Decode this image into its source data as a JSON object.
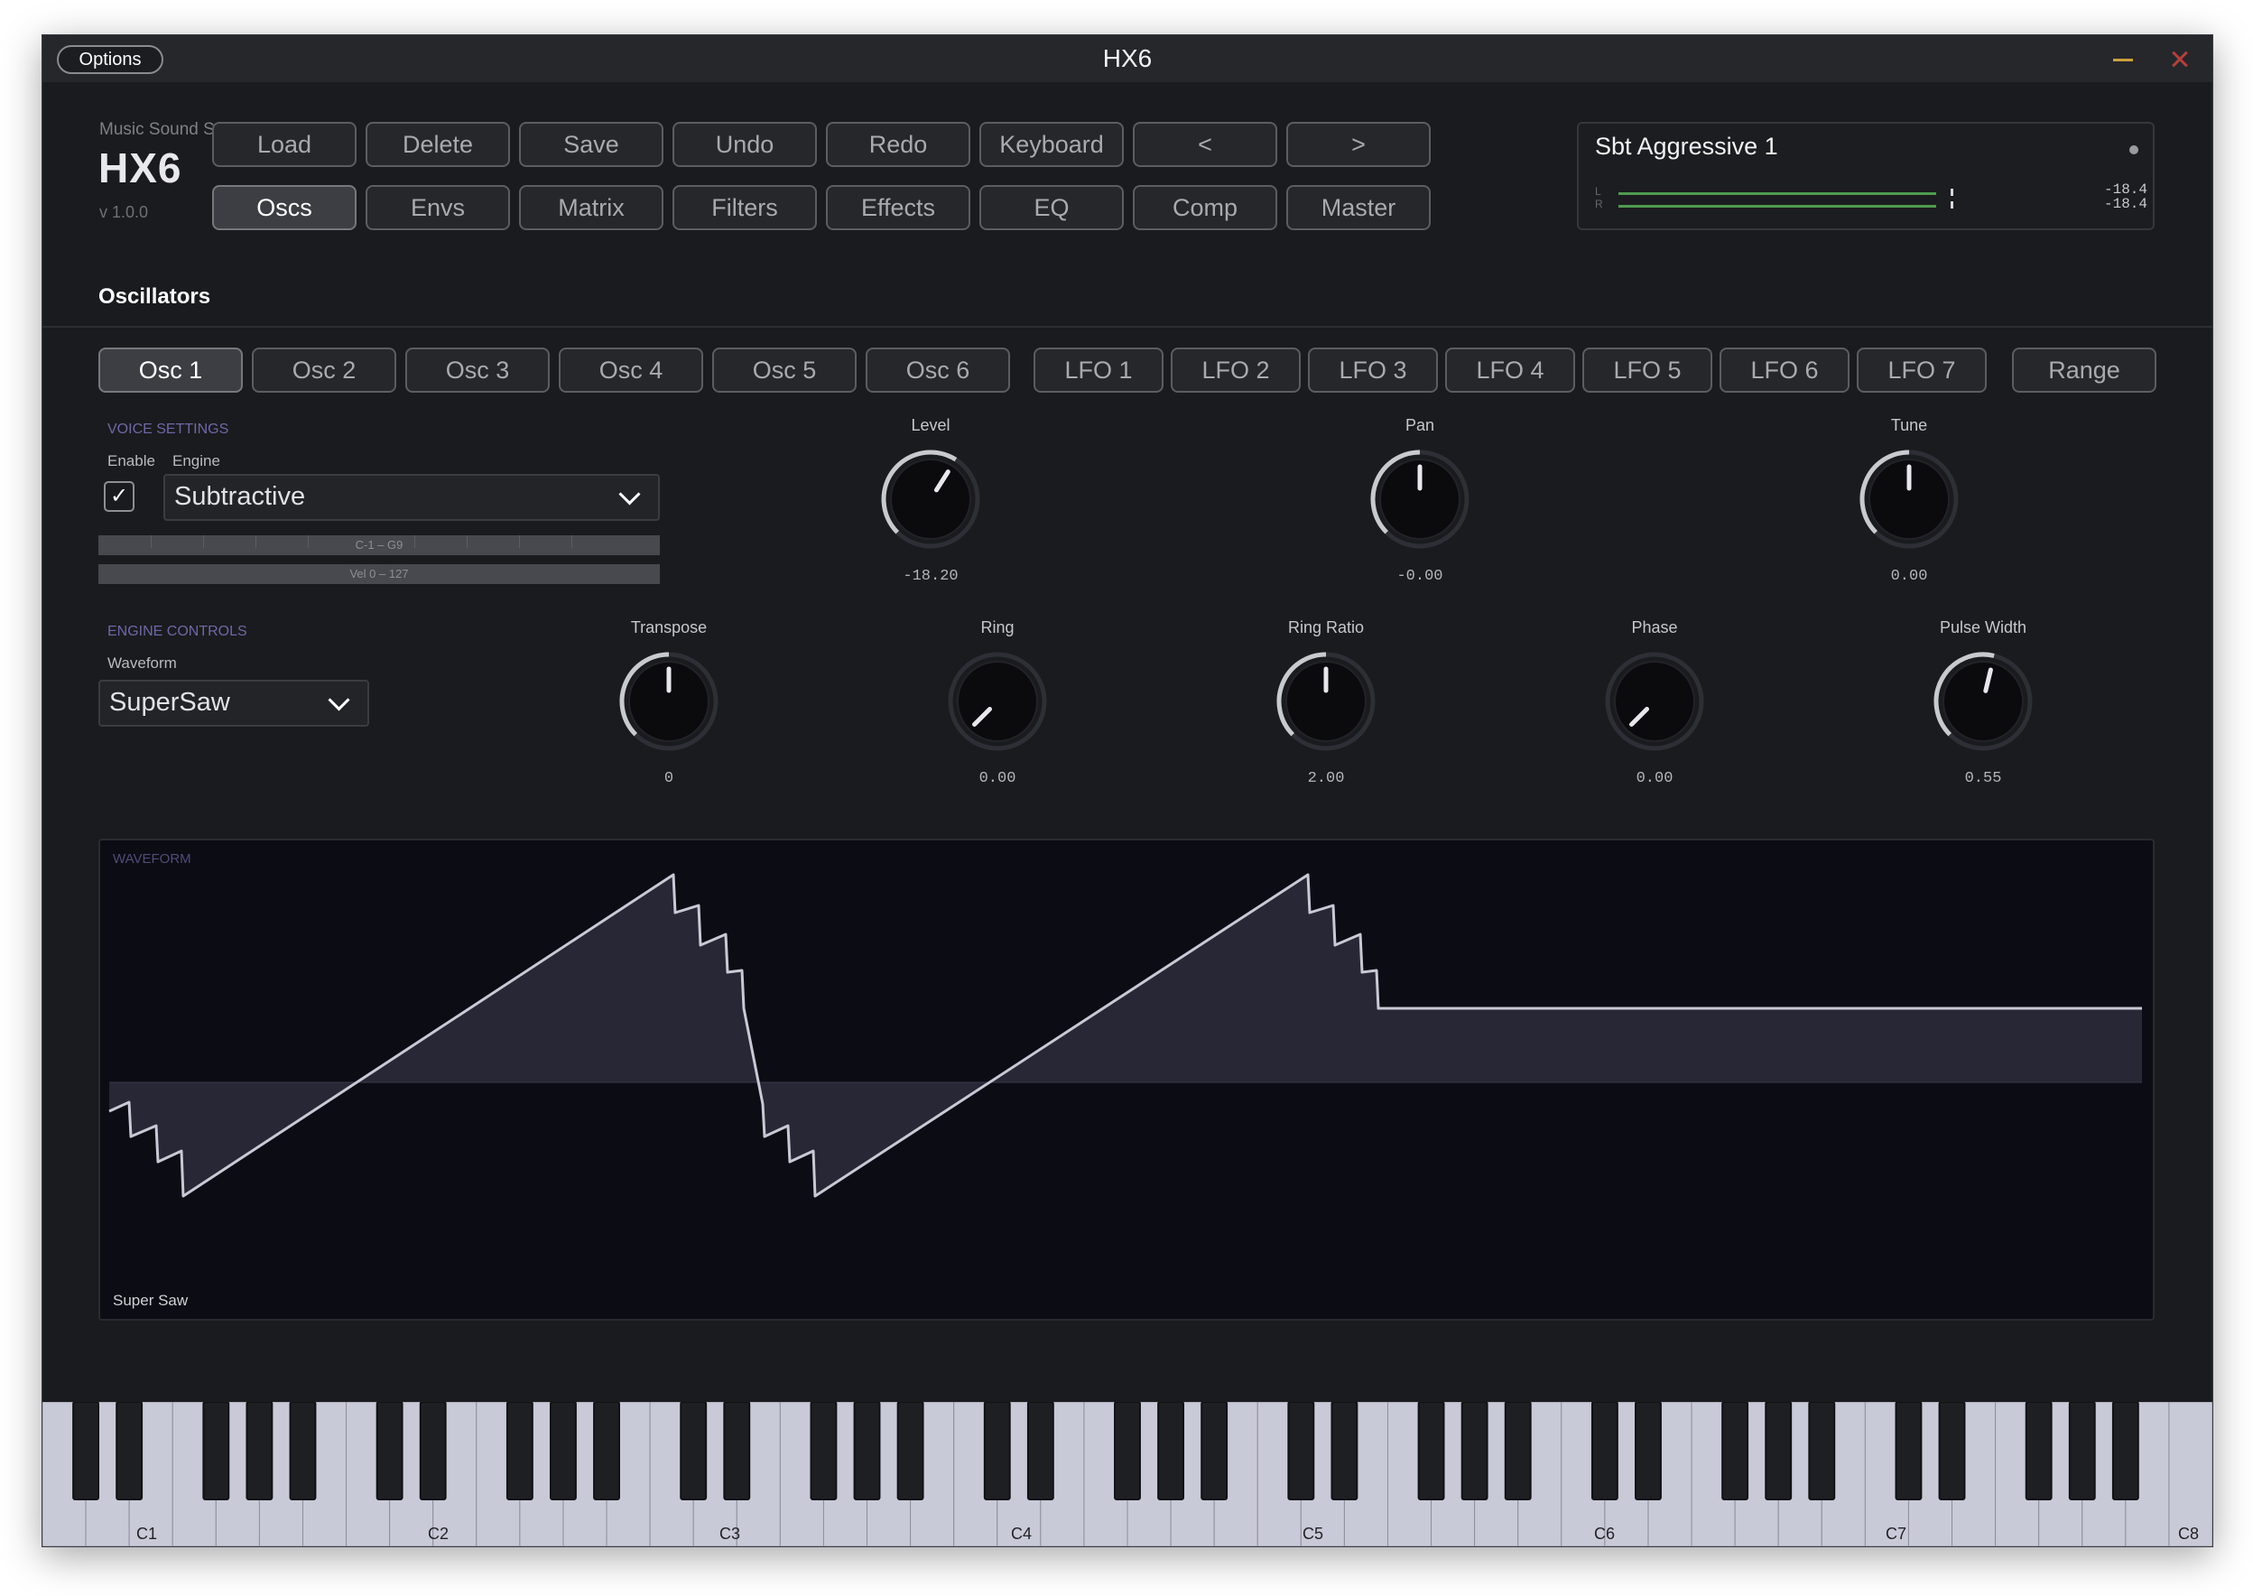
{
  "window": {
    "title": "HX6",
    "options_label": "Options"
  },
  "brand": {
    "maker": "Music Sound Software",
    "logo": "HX6",
    "version": "v 1.0.0"
  },
  "toolbar": {
    "row1": [
      "Load",
      "Delete",
      "Save",
      "Undo",
      "Redo",
      "Keyboard",
      "<",
      ">"
    ],
    "row2": [
      "Oscs",
      "Envs",
      "Matrix",
      "Filters",
      "Effects",
      "EQ",
      "Comp",
      "Master"
    ],
    "row2_active": "Oscs"
  },
  "preset": {
    "name": "Sbt Aggressive 1",
    "meter": {
      "left_label": "L",
      "right_label": "R",
      "left_value": "-18.4",
      "right_value": "-18.4",
      "bar_color": "#4f9b4f"
    }
  },
  "section_title": "Oscillators",
  "tabs": {
    "osc": [
      "Osc 1",
      "Osc 2",
      "Osc 3",
      "Osc 4",
      "Osc 5",
      "Osc 6"
    ],
    "lfo": [
      "LFO 1",
      "LFO 2",
      "LFO 3",
      "LFO 4",
      "LFO 5",
      "LFO 6",
      "LFO 7"
    ],
    "range": "Range",
    "active": "Osc 1"
  },
  "voice_settings": {
    "title": "VOICE SETTINGS",
    "enable_label": "Enable",
    "enabled": true,
    "engine_label": "Engine",
    "engine_value": "Subtractive",
    "key_range": "C-1 – G9",
    "vel_range": "Vel 0 – 127"
  },
  "engine_controls": {
    "title": "ENGINE CONTROLS",
    "waveform_label": "Waveform",
    "waveform_value": "SuperSaw"
  },
  "knobs_row1": [
    {
      "label": "Level",
      "value": "-18.20",
      "position": 0.62
    },
    {
      "label": "Pan",
      "value": "-0.00",
      "position": 0.5
    },
    {
      "label": "Tune",
      "value": "0.00",
      "position": 0.5
    }
  ],
  "knobs_row2": [
    {
      "label": "Transpose",
      "value": "0",
      "position": 0.5
    },
    {
      "label": "Ring",
      "value": "0.00",
      "position": 0.0
    },
    {
      "label": "Ring Ratio",
      "value": "2.00",
      "position": 0.5
    },
    {
      "label": "Phase",
      "value": "0.00",
      "position": 0.0
    },
    {
      "label": "Pulse Width",
      "value": "0.55",
      "position": 0.55
    }
  ],
  "waveform_display": {
    "title": "WAVEFORM",
    "caption": "Super Saw",
    "line_color": "#c9c9d6",
    "fill_color": "#2a2a38"
  },
  "keyboard": {
    "octave_labels": [
      "C1",
      "C2",
      "C3",
      "C4",
      "C5",
      "C6",
      "C7",
      "C8"
    ]
  },
  "icons": {
    "check": "checkmark-icon",
    "chevron": "chevron-down-icon",
    "close": "close-icon",
    "minimize": "minimize-icon"
  }
}
